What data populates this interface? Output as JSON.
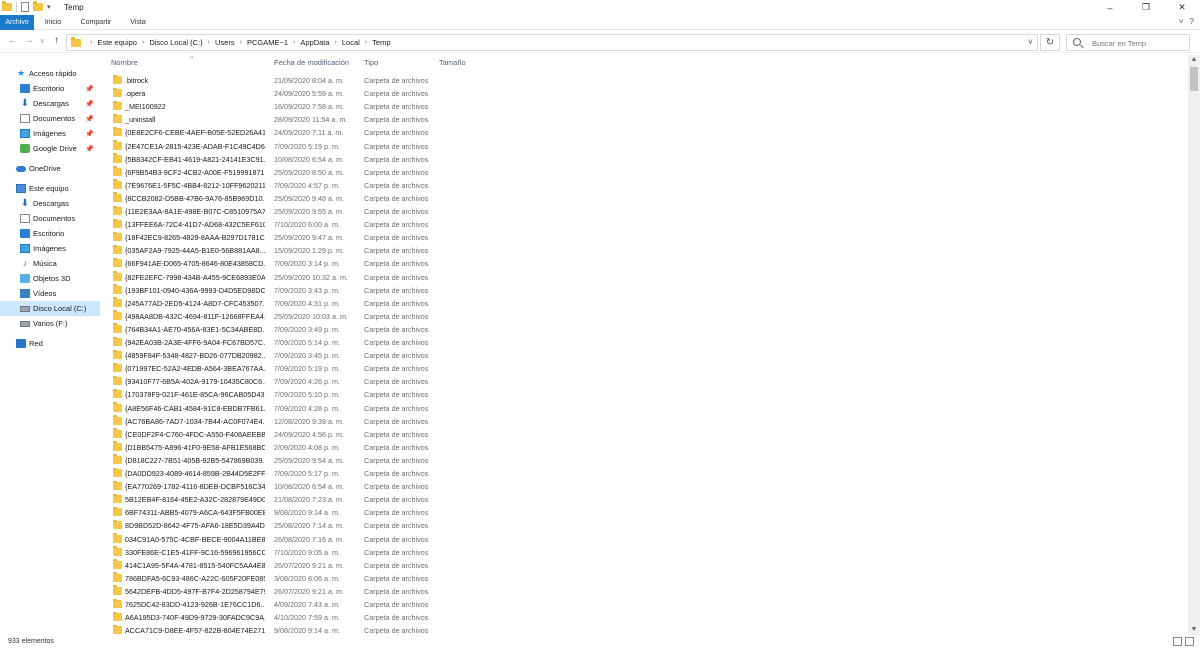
{
  "window": {
    "title": "Temp",
    "controls": [
      "–",
      "❐",
      "✕"
    ]
  },
  "ribbon": {
    "tabs": [
      "Archivo",
      "Inicio",
      "Compartir",
      "Vista"
    ],
    "chevron": "˅",
    "help": "?"
  },
  "navigation": {
    "back": "←",
    "forward": "→",
    "recent": "˅",
    "up": "↑",
    "breadcrumb": [
      "Este equipo",
      "Disco Local (C:)",
      "Users",
      "PCGAME~1",
      "AppData",
      "Local",
      "Temp"
    ],
    "separator": "›",
    "dropdown": "˅",
    "refresh": "↻",
    "search_placeholder": "Buscar en Temp"
  },
  "sidebar": {
    "items": [
      {
        "label": "Acceso rápido",
        "icon": "star-icon",
        "level": 0,
        "pinned": false
      },
      {
        "label": "Escritorio",
        "icon": "desktop-icon",
        "level": 1,
        "pinned": true
      },
      {
        "label": "Descargas",
        "icon": "download-icon",
        "level": 1,
        "pinned": true
      },
      {
        "label": "Documentos",
        "icon": "documents-icon",
        "level": 1,
        "pinned": true
      },
      {
        "label": "Imágenes",
        "icon": "pictures-icon",
        "level": 1,
        "pinned": true
      },
      {
        "label": "Google Drive",
        "icon": "google-drive-icon",
        "level": 1,
        "pinned": true
      },
      {
        "label": "OneDrive",
        "icon": "onedrive-icon",
        "level": 0,
        "pinned": false
      },
      {
        "label": "Este equipo",
        "icon": "this-pc-icon",
        "level": 0,
        "pinned": false
      },
      {
        "label": "Descargas",
        "icon": "download-icon",
        "level": 1,
        "pinned": false
      },
      {
        "label": "Documentos",
        "icon": "documents-icon",
        "level": 1,
        "pinned": false
      },
      {
        "label": "Escritorio",
        "icon": "desktop-icon",
        "level": 1,
        "pinned": false
      },
      {
        "label": "Imágenes",
        "icon": "pictures-icon",
        "level": 1,
        "pinned": false
      },
      {
        "label": "Música",
        "icon": "music-icon",
        "level": 1,
        "pinned": false
      },
      {
        "label": "Objetos 3D",
        "icon": "3d-objects-icon",
        "level": 1,
        "pinned": false
      },
      {
        "label": "Vídeos",
        "icon": "videos-icon",
        "level": 1,
        "pinned": false
      },
      {
        "label": "Disco Local (C:)",
        "icon": "local-disk-icon",
        "level": 1,
        "pinned": false,
        "selected": true
      },
      {
        "label": "Varios (F:)",
        "icon": "drive-icon",
        "level": 1,
        "pinned": false
      },
      {
        "label": "Red",
        "icon": "network-icon",
        "level": 0,
        "pinned": false
      }
    ]
  },
  "columns": {
    "name": "Nombre",
    "date": "Fecha de modificación",
    "type": "Tipo",
    "size": "Tamaño"
  },
  "files": [
    {
      "name": ".bitrock",
      "date": "21/09/2020 8:04 a. m.",
      "type": "Carpeta de archivos"
    },
    {
      "name": ".opera",
      "date": "24/09/2020 5:59 a. m.",
      "type": "Carpeta de archivos"
    },
    {
      "name": "_MEI100922",
      "date": "16/09/2020 7:58 a. m.",
      "type": "Carpeta de archivos"
    },
    {
      "name": "_uninstall",
      "date": "28/09/2020 11:54 a. m.",
      "type": "Carpeta de archivos"
    },
    {
      "name": "{0E8E2CF6-CEBE-4AEF-B05E-52ED26A41B...",
      "date": "24/09/2020 7:11 a. m.",
      "type": "Carpeta de archivos"
    },
    {
      "name": "{2E47CE1A-2815-423E-ADAB-F1C49C4D6...",
      "date": "7/09/2020 5:19 p. m.",
      "type": "Carpeta de archivos"
    },
    {
      "name": "{5B8342CF-EB41-4619-A821-24141E3C91...",
      "date": "10/08/2020 6:54 a. m.",
      "type": "Carpeta de archivos"
    },
    {
      "name": "{6F9B54B3-9CF2-4CB2-A00E-F519991871...",
      "date": "25/09/2020 8:50 a. m.",
      "type": "Carpeta de archivos"
    },
    {
      "name": "{7E9676E1-5F5C-4BB4-8212-10FF9620211D}",
      "date": "7/09/2020 4:57 p. m.",
      "type": "Carpeta de archivos"
    },
    {
      "name": "{8CCB2082-D5BB-47B6-9A76-85B969D10...",
      "date": "25/09/2020 9:48 a. m.",
      "type": "Carpeta de archivos"
    },
    {
      "name": "{11E2E3AA-8A1E-498E-B07C-C8510975A7...",
      "date": "25/09/2020 9:55 a. m.",
      "type": "Carpeta de archivos"
    },
    {
      "name": "{13FFEE6A-72C4-41D7-AD68-432C5EF610...",
      "date": "7/10/2020 6:00 a. m.",
      "type": "Carpeta de archivos"
    },
    {
      "name": "{18F42EC9-8265-4829-8AAA-B297D1781C...",
      "date": "25/09/2020 9:47 a. m.",
      "type": "Carpeta de archivos"
    },
    {
      "name": "{035AF2A9-7925-44A5-B1E0-56B881AA8...",
      "date": "15/09/2020 1:29 p. m.",
      "type": "Carpeta de archivos"
    },
    {
      "name": "{66F941AE-D065-4705-8646-80E43858CD...",
      "date": "7/09/2020 3:14 p. m.",
      "type": "Carpeta de archivos"
    },
    {
      "name": "{82FE2EFC-7998-434B-A455-9CE6893E0A...",
      "date": "25/09/2020 10:32 a. m.",
      "type": "Carpeta de archivos"
    },
    {
      "name": "{193BF101-0940-436A-9993-D4D5ED98DC...",
      "date": "7/09/2020 3:43 p. m.",
      "type": "Carpeta de archivos"
    },
    {
      "name": "{245A77AD-2ED5-4124-A8D7-CFC453507...",
      "date": "7/09/2020 4:31 p. m.",
      "type": "Carpeta de archivos"
    },
    {
      "name": "{498AA8DB-432C-4694-811F-12668FFEA4...",
      "date": "25/09/2020 10:03 a. m.",
      "type": "Carpeta de archivos"
    },
    {
      "name": "{764B34A1-AE70-456A-83E1-5C34ABE8D...",
      "date": "7/09/2020 3:49 p. m.",
      "type": "Carpeta de archivos"
    },
    {
      "name": "{942EA03B-2A3E-4FF6-9A04-FC67BD57C...",
      "date": "7/09/2020 5:14 p. m.",
      "type": "Carpeta de archivos"
    },
    {
      "name": "{4859F84F-5348-4827-BD26-077DB20982...",
      "date": "7/09/2020 3:45 p. m.",
      "type": "Carpeta de archivos"
    },
    {
      "name": "{071997EC-52A2-4EDB-A564-3BEA767AA...",
      "date": "7/09/2020 5:19 p. m.",
      "type": "Carpeta de archivos"
    },
    {
      "name": "{93410F77-6B5A-402A-9179-10435C80C6...",
      "date": "7/09/2020 4:26 p. m.",
      "type": "Carpeta de archivos"
    },
    {
      "name": "{170378F9-021F-461E-85CA-96CAB05D43...",
      "date": "7/09/2020 5:10 p. m.",
      "type": "Carpeta de archivos"
    },
    {
      "name": "{A8E56F46-CAB1-4584-91C8-EBDB7FB61...",
      "date": "7/09/2020 4:28 p. m.",
      "type": "Carpeta de archivos"
    },
    {
      "name": "{AC76BA86-7AD7-1034-7B44-AC0F074E4...",
      "date": "12/08/2020 9:39 a. m.",
      "type": "Carpeta de archivos"
    },
    {
      "name": "{CE0DF2F4-C760-4FDC-A550-F408AEEBB...",
      "date": "24/09/2020 4:56 p. m.",
      "type": "Carpeta de archivos"
    },
    {
      "name": "{D1BB5475-A896-41F0-9E58-AFB1E568BC...",
      "date": "2/09/2020 4:08 p. m.",
      "type": "Carpeta de archivos"
    },
    {
      "name": "{D818C227-7B51-405B-92B5-547869B039...",
      "date": "25/09/2020 9:54 a. m.",
      "type": "Carpeta de archivos"
    },
    {
      "name": "{DA0DD923-4089-4614-859B-2B44D5E2FF...",
      "date": "7/09/2020 5:17 p. m.",
      "type": "Carpeta de archivos"
    },
    {
      "name": "{EA770269-1782-4116-8DEB-DCBF516C34...",
      "date": "10/08/2020 6:54 a. m.",
      "type": "Carpeta de archivos"
    },
    {
      "name": "5B12EB4F-8164-45E2-A32C-282879E49D0E",
      "date": "21/08/2020 7:23 a. m.",
      "type": "Carpeta de archivos"
    },
    {
      "name": "6BF74311-ABB5-4079-A6CA-643F5FB00EE6",
      "date": "9/08/2020 9:14 a. m.",
      "type": "Carpeta de archivos"
    },
    {
      "name": "8D9BD52D-8642-4F75-AFA6-18E5D39A4D...",
      "date": "25/08/2020 7:14 a. m.",
      "type": "Carpeta de archivos"
    },
    {
      "name": "034C91A0-575C-4CBF-BECE-9004A11BE8...",
      "date": "26/08/2020 7:16 a. m.",
      "type": "Carpeta de archivos"
    },
    {
      "name": "330FE86E-C1E5-41FF-9C16-596961956CCE",
      "date": "7/10/2020 9:05 a. m.",
      "type": "Carpeta de archivos"
    },
    {
      "name": "414C1A95-5F4A-4781-8515-540FC5AA4E80",
      "date": "26/07/2020 9:21 a. m.",
      "type": "Carpeta de archivos"
    },
    {
      "name": "786BDFA5-6C93-486C-A22C-605F20FE0851",
      "date": "3/08/2020 8:06 a. m.",
      "type": "Carpeta de archivos"
    },
    {
      "name": "5642DEFB-4DD5-497F-B7F4-2D258794E799",
      "date": "26/07/2020 9:21 a. m.",
      "type": "Carpeta de archivos"
    },
    {
      "name": "7625DC42-83DD-4123-926B-1E76CC1D6...",
      "date": "4/09/2020 7:43 a. m.",
      "type": "Carpeta de archivos"
    },
    {
      "name": "A6A195D3-740F-49D9-9729-30FADC9C9A...",
      "date": "4/10/2020 7:59 a. m.",
      "type": "Carpeta de archivos"
    },
    {
      "name": "ACCA71C9-D8EE-4F57-822B-804E74E2711B",
      "date": "9/08/2020 9:14 a. m.",
      "type": "Carpeta de archivos"
    }
  ],
  "status": {
    "count": "933 elementos"
  },
  "colors": {
    "accent": "#1979ca",
    "selection": "#cce8ff",
    "folder": "#f5c84a"
  }
}
